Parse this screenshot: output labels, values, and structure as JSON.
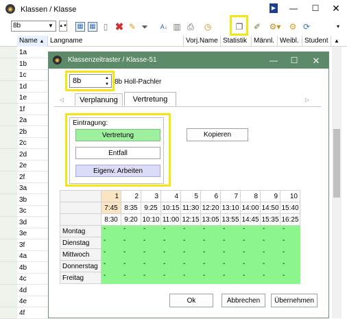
{
  "window": {
    "title": "Klassen / Klasse"
  },
  "toolbar": {
    "class_select": "8b"
  },
  "list": {
    "columns": [
      "Name",
      "Langname",
      "Vorj.Name",
      "Statistik",
      "Männl.",
      "Weibl.",
      "Student"
    ],
    "rows": [
      "1a",
      "1b",
      "1c",
      "1d",
      "1e",
      "1f",
      "2a",
      "2b",
      "2c",
      "2d",
      "2e",
      "2f",
      "3a",
      "3b",
      "3c",
      "3d",
      "3e",
      "3f",
      "4a",
      "4b",
      "4c",
      "4d",
      "4e",
      "4f"
    ]
  },
  "dialog": {
    "title": "Klassenzeitraster / Klasse-51",
    "class_value": "8b",
    "class_name": "8b Holl-Pachler",
    "tabs": [
      "Verplanung",
      "Vertretung"
    ],
    "entry_group_label": "Eintragung:",
    "entry_buttons": [
      "Vertretung",
      "Entfall",
      "Eigenv. Arbeiten"
    ],
    "copy_button": "Kopieren",
    "periods": [
      "1",
      "2",
      "3",
      "4",
      "5",
      "6",
      "7",
      "8",
      "9",
      "10"
    ],
    "start_times": [
      "7:45",
      "8:35",
      "9:25",
      "10:15",
      "11:30",
      "12:20",
      "13:10",
      "14:00",
      "14:50",
      "15:40"
    ],
    "end_times": [
      "8:30",
      "9:20",
      "10:10",
      "11:00",
      "12:15",
      "13:05",
      "13:55",
      "14:45",
      "15:35",
      "16:25"
    ],
    "days": [
      "Montag",
      "Dienstag",
      "Mittwoch",
      "Donnerstag",
      "Freitag"
    ],
    "cell_mark": "-",
    "ok_button": "Ok",
    "cancel_button": "Abbrechen",
    "apply_button": "Übernehmen"
  },
  "colors": {
    "accent_green": "#5d8a68",
    "highlight": "#f5e512",
    "cell_green": "#8cf58c",
    "selected_period": "#fbe4c2"
  }
}
